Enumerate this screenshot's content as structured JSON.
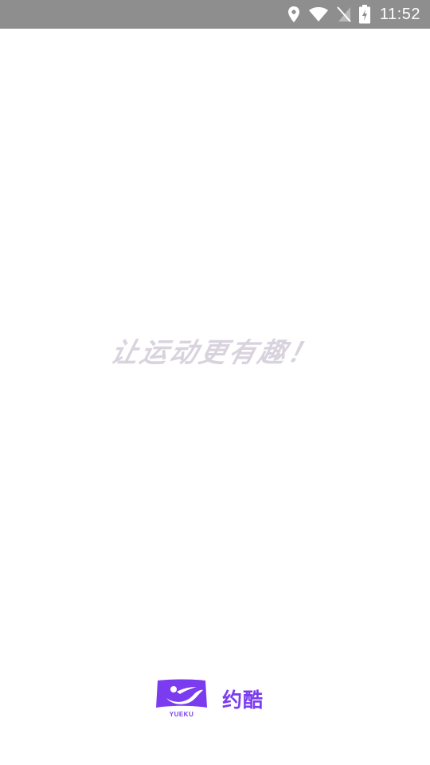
{
  "status_bar": {
    "time": "11:52",
    "icons": [
      "location-icon",
      "wifi-icon",
      "no-sim-icon",
      "battery-charging-icon"
    ]
  },
  "splash": {
    "slogan": "让运动更有趣！"
  },
  "brand": {
    "logo_caption": "YUEKU",
    "name": "约酷",
    "color": "#7b3cf0"
  },
  "colors": {
    "status_bar_bg": "#8e8e8e",
    "slogan": "#d9d3de",
    "background": "#ffffff"
  }
}
